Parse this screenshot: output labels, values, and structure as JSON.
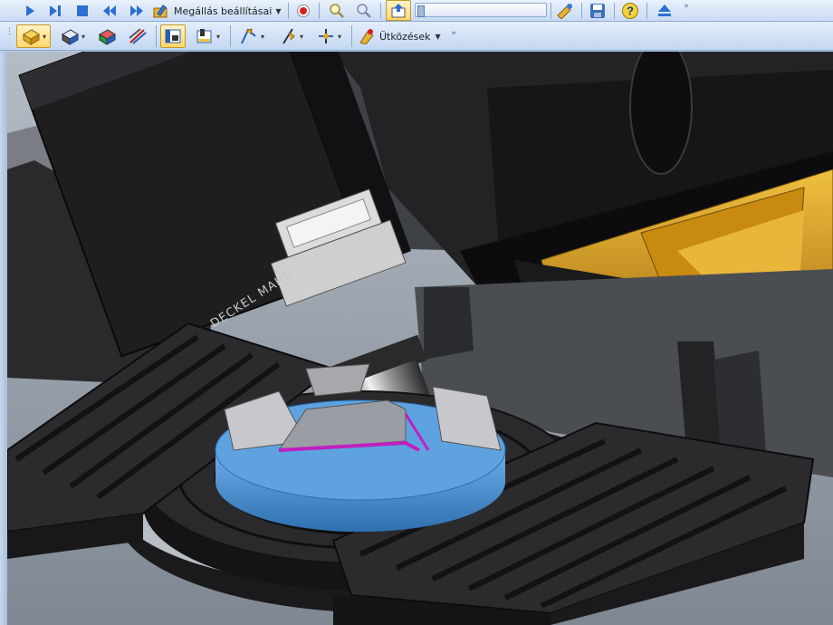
{
  "toolbar1": {
    "stop_settings_label": "Megállás beállításai",
    "icons": [
      "play-icon",
      "step-icon",
      "stop-icon",
      "rewind-icon",
      "fast-forward-icon",
      "stop-settings-icon",
      "record-icon",
      "zoom-in-icon",
      "zoom-out-icon",
      "export-icon",
      "slider",
      "magic-icon",
      "save-icon",
      "help-icon",
      "eject-icon"
    ]
  },
  "toolbar2": {
    "collisions_label": "Ütközések",
    "icons": [
      "view-box-icon",
      "view-tool-icon",
      "view-part-icon",
      "section-icon",
      "display-mode-icon",
      "machine-view-icon",
      "tool-path-icon",
      "axis-icon",
      "axis-tool-icon",
      "collisions-icon"
    ]
  },
  "viewport": {
    "head_brand": "DECKEL MAHO"
  },
  "colors": {
    "toolbar_bg": "#d6e4f5",
    "machine_dark": "#1a1a1a",
    "table_blue": "#4f97d6",
    "gold_rail": "#d9a120",
    "toolpath_magenta": "#c020c0"
  }
}
